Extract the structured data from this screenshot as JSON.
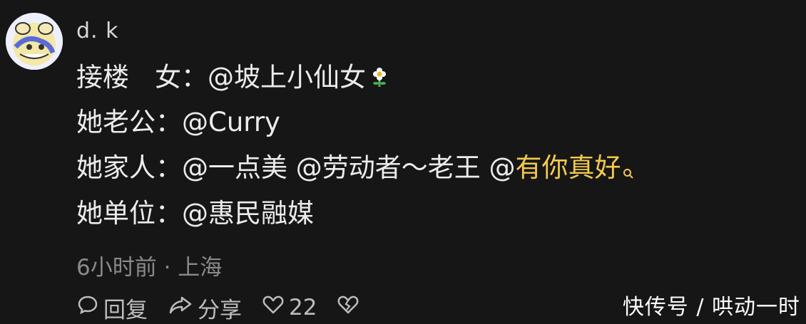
{
  "comment": {
    "username": "d. k",
    "lines": [
      {
        "label": "接楼",
        "text": "女：@坡上小仙女"
      },
      {
        "text": "她老公：@Curry"
      },
      {
        "text_before": "她家人：@一点美 @劳动者～老王 @",
        "highlight": "有你真好"
      },
      {
        "text": "她单位：@惠民融媒"
      }
    ],
    "meta": "6小时前 · 上海",
    "actions": {
      "reply_label": "回复",
      "share_label": "分享",
      "like_count": "22"
    },
    "highlight_color": "#f2c94c"
  },
  "watermark": "快传号 / 哄动一时",
  "icons": [
    "avatar",
    "flower-emoji",
    "search-icon",
    "comment-icon",
    "share-icon",
    "heart-icon",
    "broken-heart-icon"
  ]
}
